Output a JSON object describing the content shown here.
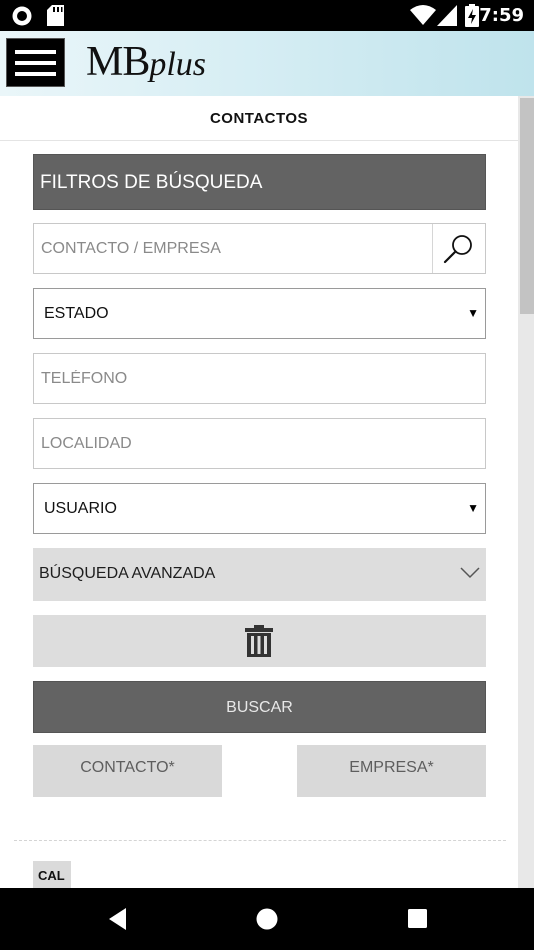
{
  "status_bar": {
    "time": "7:59",
    "icons": [
      "record-icon",
      "sd-card-icon",
      "wifi-icon",
      "signal-icon",
      "battery-charging-icon"
    ]
  },
  "header": {
    "logo_main": "MB",
    "logo_sub": "plus",
    "menu_icon": "hamburger-menu-icon"
  },
  "page": {
    "title": "CONTACTOS"
  },
  "filters": {
    "header": "FILTROS DE BÚSQUEDA",
    "contact_company_placeholder": "CONTACTO / EMPRESA",
    "state_selected": "ESTADO",
    "phone_placeholder": "TELÉFONO",
    "locality_placeholder": "LOCALIDAD",
    "user_selected": "USUARIO",
    "advanced_search_label": "BÚSQUEDA AVANZADA",
    "search_button": "BUSCAR",
    "contact_button": "CONTACTO*",
    "company_button": "EMPRESA*"
  },
  "list": {
    "first_badge": "CAL"
  },
  "colors": {
    "header_dark": "#636363",
    "button_light": "#dddddd",
    "app_bar_gradient_start": "#eaf6f9",
    "app_bar_gradient_end": "#bfe3ec"
  }
}
